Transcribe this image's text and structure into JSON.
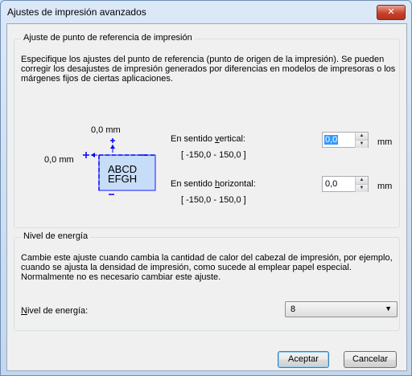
{
  "window": {
    "title": "Ajustes de impresión avanzados",
    "close_glyph": "✕"
  },
  "reference": {
    "legend": "Ajuste de punto de referencia de impresión",
    "description": [
      "Especifique los ajustes del punto de referencia (punto de origen de la impresión). Se pueden",
      "corregir los desajustes de impresión generados por diferencias en modelos de impresoras o los",
      "márgenes fijos de ciertas aplicaciones."
    ],
    "diagram": {
      "top_offset": "0,0 mm",
      "left_offset": "0,0 mm",
      "sample_line1": "ABCD",
      "sample_line2": "EFGH"
    },
    "vertical": {
      "label_pre": "En sentido ",
      "label_key": "v",
      "label_post": "ertical:",
      "range": "[ -150,0 - 150,0 ]",
      "value": "0,0",
      "unit": "mm"
    },
    "horizontal": {
      "label_pre": "En sentido ",
      "label_key": "h",
      "label_post": "orizontal:",
      "range": "[ -150,0 - 150,0 ]",
      "value": "0,0",
      "unit": "mm"
    }
  },
  "energy": {
    "legend": "Nivel de energía",
    "description": [
      "Cambie este ajuste cuando cambia la cantidad de calor del cabezal de impresión, por ejemplo,",
      "cuando se ajusta la densidad de impresión, como sucede al emplear papel especial.",
      "Normalmente no es necesario cambiar este ajuste."
    ],
    "label_key": "N",
    "label_rest": "ivel de energía:",
    "selected": "8"
  },
  "buttons": {
    "ok": "Aceptar",
    "cancel": "Cancelar"
  },
  "colors": {
    "accent_blue": "#0000ff",
    "sample_fill": "#c7dcf7",
    "selection": "#3399ff"
  }
}
